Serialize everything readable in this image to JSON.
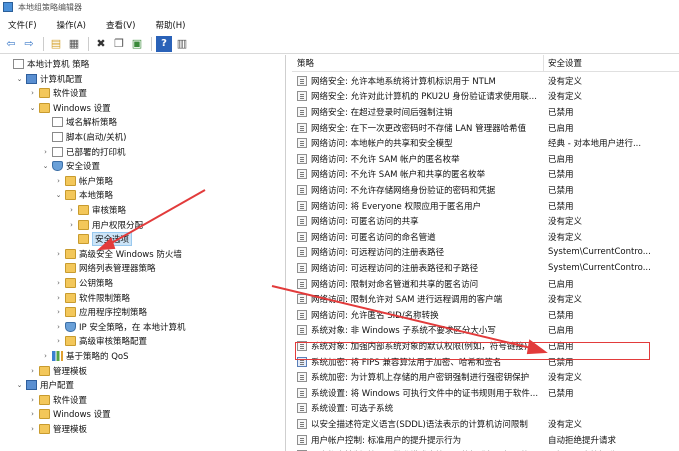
{
  "window": {
    "title": "本地组策略编辑器"
  },
  "menu": [
    {
      "label": "文件(F)"
    },
    {
      "label": "操作(A)"
    },
    {
      "label": "查看(V)"
    },
    {
      "label": "帮助(H)"
    }
  ],
  "toolbar": [
    {
      "icon": "back-arrow-icon",
      "glyph": "⇦"
    },
    {
      "icon": "forward-arrow-icon",
      "glyph": "⇨"
    },
    {
      "icon": "up-folder-icon",
      "glyph": "▤"
    },
    {
      "icon": "show-hide-tree-icon",
      "glyph": "▦"
    },
    {
      "icon": "delete-icon",
      "glyph": "✖"
    },
    {
      "icon": "copy-icon",
      "glyph": "❐"
    },
    {
      "icon": "export-list-icon",
      "glyph": "▣"
    },
    {
      "icon": "help-icon",
      "glyph": "?"
    },
    {
      "icon": "properties-icon",
      "glyph": "▥"
    }
  ],
  "tree": [
    {
      "label": "本地计算机 策略",
      "depth": 0,
      "twisty": "",
      "icon": "doc"
    },
    {
      "label": "计算机配置",
      "depth": 1,
      "twisty": "⌄",
      "icon": "pc"
    },
    {
      "label": "软件设置",
      "depth": 2,
      "twisty": "›",
      "icon": "folder"
    },
    {
      "label": "Windows 设置",
      "depth": 2,
      "twisty": "⌄",
      "icon": "folder"
    },
    {
      "label": "域名解析策略",
      "depth": 3,
      "twisty": "",
      "icon": "doc"
    },
    {
      "label": "脚本(启动/关机)",
      "depth": 3,
      "twisty": "",
      "icon": "doc"
    },
    {
      "label": "已部署的打印机",
      "depth": 3,
      "twisty": "›",
      "icon": "doc"
    },
    {
      "label": "安全设置",
      "depth": 3,
      "twisty": "⌄",
      "icon": "shield"
    },
    {
      "label": "帐户策略",
      "depth": 4,
      "twisty": "›",
      "icon": "folder"
    },
    {
      "label": "本地策略",
      "depth": 4,
      "twisty": "⌄",
      "icon": "folder"
    },
    {
      "label": "审核策略",
      "depth": 5,
      "twisty": "›",
      "icon": "folder"
    },
    {
      "label": "用户权限分配",
      "depth": 5,
      "twisty": "›",
      "icon": "folder"
    },
    {
      "label": "安全选项",
      "depth": 5,
      "twisty": "",
      "icon": "folder",
      "selected": true
    },
    {
      "label": "高级安全 Windows 防火墙",
      "depth": 4,
      "twisty": "›",
      "icon": "folder"
    },
    {
      "label": "网络列表管理器策略",
      "depth": 4,
      "twisty": "",
      "icon": "folder"
    },
    {
      "label": "公钥策略",
      "depth": 4,
      "twisty": "›",
      "icon": "folder"
    },
    {
      "label": "软件限制策略",
      "depth": 4,
      "twisty": "›",
      "icon": "folder"
    },
    {
      "label": "应用程序控制策略",
      "depth": 4,
      "twisty": "›",
      "icon": "folder"
    },
    {
      "label": "IP 安全策略，在 本地计算机",
      "depth": 4,
      "twisty": "›",
      "icon": "shield"
    },
    {
      "label": "高级审核策略配置",
      "depth": 4,
      "twisty": "›",
      "icon": "folder"
    },
    {
      "label": "基于策略的 QoS",
      "depth": 3,
      "twisty": "›",
      "icon": "chart"
    },
    {
      "label": "管理模板",
      "depth": 2,
      "twisty": "›",
      "icon": "folder"
    },
    {
      "label": "用户配置",
      "depth": 1,
      "twisty": "⌄",
      "icon": "pc"
    },
    {
      "label": "软件设置",
      "depth": 2,
      "twisty": "›",
      "icon": "folder"
    },
    {
      "label": "Windows 设置",
      "depth": 2,
      "twisty": "›",
      "icon": "folder"
    },
    {
      "label": "管理模板",
      "depth": 2,
      "twisty": "›",
      "icon": "folder"
    }
  ],
  "list": {
    "col_policy": "策略",
    "col_setting": "安全设置",
    "rows": [
      {
        "policy": "网络安全: 允许本地系统将计算机标识用于 NTLM",
        "setting": "没有定义"
      },
      {
        "policy": "网络安全: 允许对此计算机的 PKU2U 身份验证请求使用联...",
        "setting": "没有定义"
      },
      {
        "policy": "网络安全: 在超过登录时间后强制注销",
        "setting": "已禁用"
      },
      {
        "policy": "网络安全: 在下一次更改密码时不存储 LAN 管理器哈希值",
        "setting": "已启用"
      },
      {
        "policy": "网络访问: 本地帐户的共享和安全模型",
        "setting": "经典 - 对本地用户进行..."
      },
      {
        "policy": "网络访问: 不允许 SAM 帐户的匿名枚举",
        "setting": "已启用"
      },
      {
        "policy": "网络访问: 不允许 SAM 帐户和共享的匿名枚举",
        "setting": "已禁用"
      },
      {
        "policy": "网络访问: 不允许存储网络身份验证的密码和凭据",
        "setting": "已禁用"
      },
      {
        "policy": "网络访问: 将 Everyone 权限应用于匿名用户",
        "setting": "已禁用"
      },
      {
        "policy": "网络访问: 可匿名访问的共享",
        "setting": "没有定义"
      },
      {
        "policy": "网络访问: 可匿名访问的命名管道",
        "setting": "没有定义"
      },
      {
        "policy": "网络访问: 可远程访问的注册表路径",
        "setting": "System\\CurrentContro..."
      },
      {
        "policy": "网络访问: 可远程访问的注册表路径和子路径",
        "setting": "System\\CurrentContro..."
      },
      {
        "policy": "网络访问: 限制对命名管道和共享的匿名访问",
        "setting": "已启用"
      },
      {
        "policy": "网络访问: 限制允许对 SAM 进行远程调用的客户端",
        "setting": "没有定义"
      },
      {
        "policy": "网络访问: 允许匿名 SID/名称转换",
        "setting": "已禁用"
      },
      {
        "policy": "系统对象: 非 Windows 子系统不要求区分大小写",
        "setting": "已启用"
      },
      {
        "policy": "系统对象: 加强内部系统对象的默认权限(例如，符号链接)",
        "setting": "已启用"
      },
      {
        "policy": "系统加密: 将 FIPS 兼容算法用于加密、哈希和签名",
        "setting": "已禁用",
        "highlight": true
      },
      {
        "policy": "系统加密: 为计算机上存储的用户密钥强制进行强密钥保护",
        "setting": "没有定义"
      },
      {
        "policy": "系统设置: 将 Windows 可执行文件中的证书规则用于软件...",
        "setting": "已禁用"
      },
      {
        "policy": "系统设置: 可选子系统",
        "setting": ""
      },
      {
        "policy": "以安全描述符定义语言(SDDL)语法表示的计算机访问限制",
        "setting": "没有定义"
      },
      {
        "policy": "用户帐户控制: 标准用户的提升提示行为",
        "setting": "自动拒绝提升请求"
      },
      {
        "policy": "用户帐户控制: 管理员批准模式中管理员的提升权限提示的...",
        "setting": "不提示，直接提升"
      }
    ]
  },
  "annotation": {
    "color": "#e23b3b"
  }
}
